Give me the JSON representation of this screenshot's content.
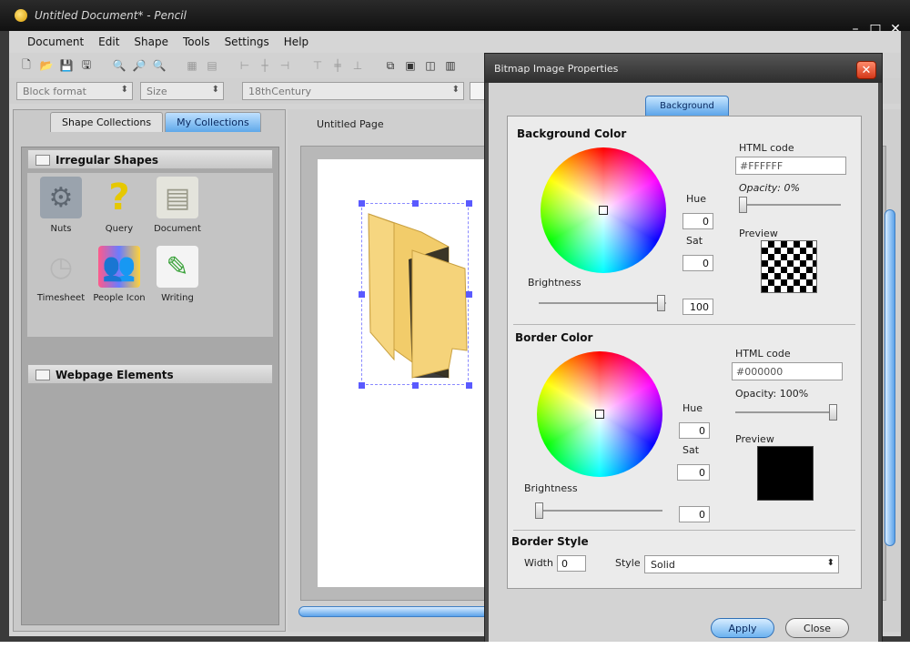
{
  "window": {
    "title": "Untitled Document* - Pencil",
    "controls": [
      "–",
      "□",
      "✕"
    ]
  },
  "menubar": {
    "items": [
      {
        "label": "Document"
      },
      {
        "label": "Edit"
      },
      {
        "label": "Shape"
      },
      {
        "label": "Tools"
      },
      {
        "label": "Settings"
      },
      {
        "label": "Help"
      }
    ]
  },
  "formatbar": {
    "block_format": "Block format",
    "size": "Size",
    "font": "18thCentury"
  },
  "collections": {
    "tabs": [
      {
        "label": "Shape Collections"
      },
      {
        "label": "My Collections"
      }
    ],
    "groups": [
      {
        "title": "Irregular Shapes"
      },
      {
        "title": "Webpage Elements"
      }
    ],
    "shapes": [
      {
        "label": "Nuts",
        "icon": "nuts-icon"
      },
      {
        "label": "Query",
        "icon": "question-icon"
      },
      {
        "label": "Document",
        "icon": "document-icon"
      },
      {
        "label": "Timesheet",
        "icon": "clock-icon"
      },
      {
        "label": "People Icon",
        "icon": "people-icon"
      },
      {
        "label": "Writing",
        "icon": "writing-icon"
      }
    ]
  },
  "canvas": {
    "page_tab": "Untitled Page"
  },
  "dialog": {
    "title": "Bitmap Image Properties",
    "tab": "Background",
    "background_color": {
      "title": "Background Color",
      "html_code_label": "HTML code",
      "html_code": "#FFFFFF",
      "opacity_label": "Opacity: 0%",
      "opacity": 0,
      "preview_label": "Preview",
      "hue_label": "Hue",
      "hue": "0",
      "sat_label": "Sat",
      "sat": "0",
      "brightness_label": "Brightness",
      "brightness": "100"
    },
    "border_color": {
      "title": "Border Color",
      "html_code_label": "HTML code",
      "html_code": "#000000",
      "opacity_label": "Opacity: 100%",
      "opacity": 100,
      "preview_label": "Preview",
      "hue_label": "Hue",
      "hue": "0",
      "sat_label": "Sat",
      "sat": "0",
      "brightness_label": "Brightness",
      "brightness": "0"
    },
    "border_style": {
      "title": "Border Style",
      "width_label": "Width",
      "width": "0",
      "style_label": "Style",
      "style": "Solid"
    },
    "apply_label": "Apply",
    "close_label": "Close"
  }
}
